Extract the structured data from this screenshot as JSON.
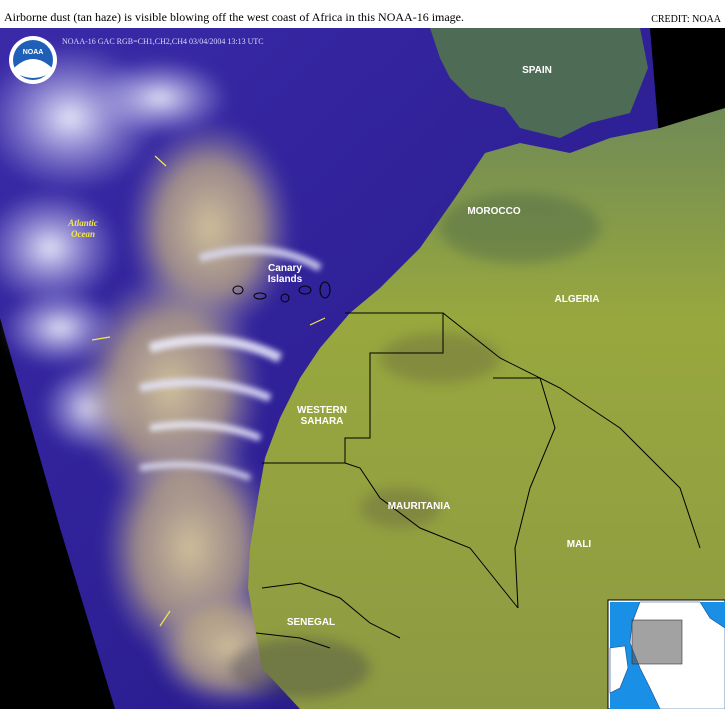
{
  "caption": "Airborne dust (tan haze) is visible blowing off the west coast of Africa in this NOAA-16 image.",
  "credit": "CREDIT: NOAA",
  "stamp": "NOAA-16  GAC  RGB=CH1,CH2,CH4  03/04/2004  13:13 UTC",
  "logo": "NOAA",
  "labels": {
    "spain": "SPAIN",
    "morocco": "MOROCCO",
    "algeria": "ALGERIA",
    "canary_1": "Canary",
    "canary_2": "Islands",
    "western_sahara_1": "WESTERN",
    "western_sahara_2": "SAHARA",
    "mauritania": "MAURITANIA",
    "mali": "MALI",
    "senegal": "SENEGAL",
    "atlantic_1": "Atlantic",
    "atlantic_2": "Ocean"
  },
  "colors": {
    "ocean": "#2a1c8c",
    "land": "#8f9d3a",
    "dust": "#c9b88a",
    "cloud": "#dcdcf2",
    "border": "#000000",
    "arrow": "#f3e84a"
  }
}
